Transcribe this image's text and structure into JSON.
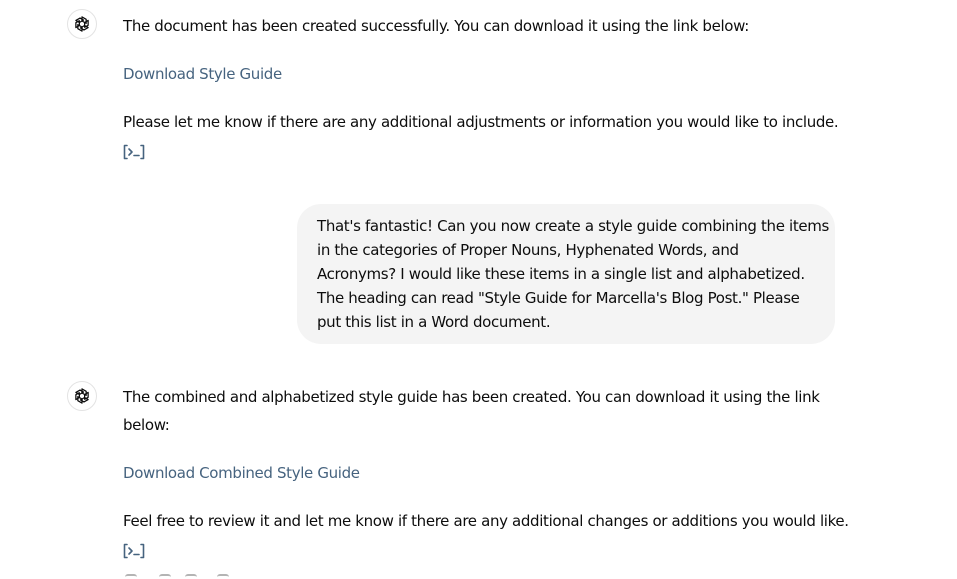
{
  "messages": [
    {
      "role": "assistant",
      "intro": "The document has been created successfully. You can download it using the link below:",
      "link": "Download Style Guide",
      "outro": "Please let me know if there are any additional adjustments or information you would like to include.",
      "icon": "code-interpreter-icon"
    },
    {
      "role": "user",
      "lines": [
        "That's fantastic! Can you now create a style guide combining the items",
        "in the categories of Proper Nouns, Hyphenated Words, and",
        "Acronyms? I would like these items in a single list and alphabetized.",
        "The heading can read \"Style Guide for Marcella's Blog Post.\" Please",
        "put this list in a Word document."
      ]
    },
    {
      "role": "assistant",
      "intro": "The combined and alphabetized style guide has been created. You can download it using the link below:",
      "link": "Download Combined Style Guide",
      "outro": "Feel free to review it and let me know if there are any additional changes or additions you would like.",
      "icon": "code-interpreter-icon"
    }
  ],
  "colors": {
    "link": "#46637f",
    "user_bubble_bg": "#f4f4f4",
    "text": "#0d0d0d"
  }
}
